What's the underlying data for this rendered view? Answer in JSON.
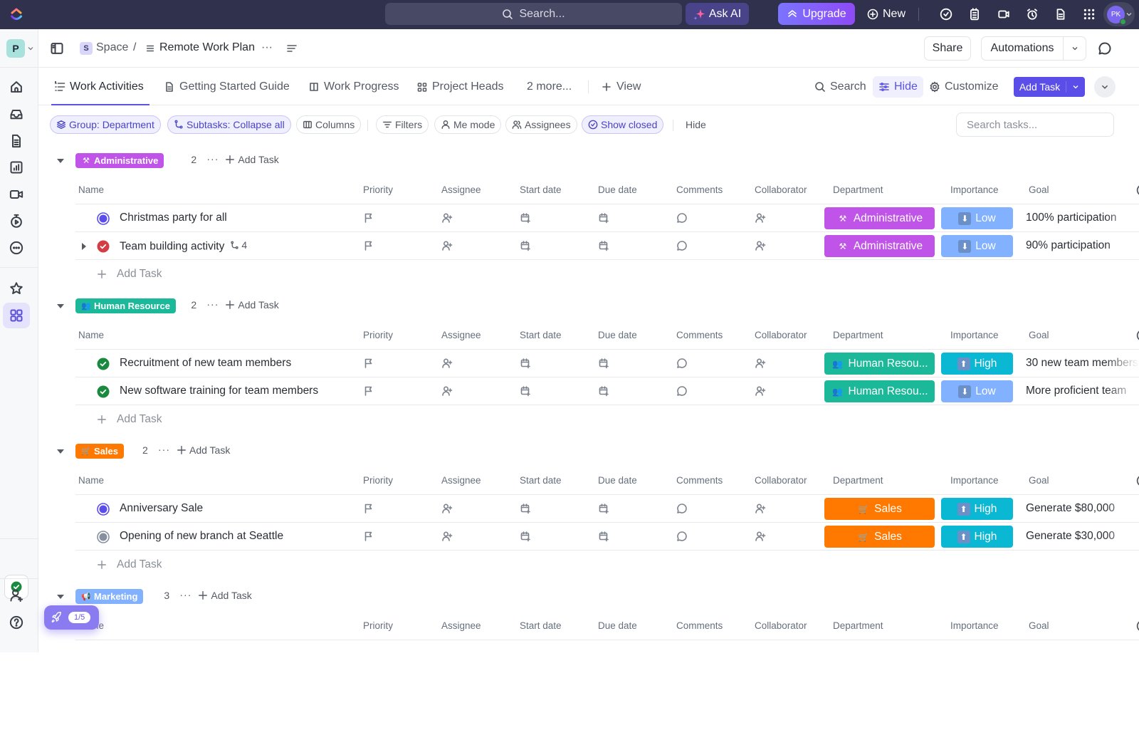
{
  "topbar": {
    "search_placeholder": "Search...",
    "ask_ai_label": "Ask AI",
    "upgrade_label": "Upgrade",
    "new_label": "New",
    "avatar_initials": "PK"
  },
  "rail": {
    "workspace_initial": "P",
    "icons": [
      "home-icon",
      "inbox-icon",
      "docs-icon",
      "dashboards-icon",
      "clips-icon",
      "timesheet-icon",
      "more-icon",
      "favorites-icon",
      "spaces-icon"
    ]
  },
  "header": {
    "space_badge": "S",
    "space_label": "Space",
    "separator": "/",
    "list_title": "Remote Work Plan",
    "more": "···",
    "share_label": "Share",
    "automations_label": "Automations"
  },
  "tabs": {
    "items": [
      {
        "label": "Work Activities",
        "active": true
      },
      {
        "label": "Getting Started Guide",
        "active": false
      },
      {
        "label": "Work Progress",
        "active": false
      },
      {
        "label": "Project Heads",
        "active": false
      }
    ],
    "more_label": "2 more...",
    "add_view_label": "View",
    "search_label": "Search",
    "hide_label": "Hide",
    "customize_label": "Customize",
    "add_task_label": "Add Task"
  },
  "filters": {
    "group_label": "Group: Department",
    "subtasks_label": "Subtasks: Collapse all",
    "columns_label": "Columns",
    "filters_label": "Filters",
    "me_mode_label": "Me mode",
    "assignees_label": "Assignees",
    "show_closed_label": "Show closed",
    "hide_label": "Hide",
    "search_placeholder": "Search tasks..."
  },
  "columns": [
    "Name",
    "Priority",
    "Assignee",
    "Start date",
    "Due date",
    "Comments",
    "Collaborator",
    "Department",
    "Importance",
    "Goal"
  ],
  "add_task_label": "Add Task",
  "colors": {
    "accent": "#5b4de8",
    "administrative": "#c053e8",
    "human_resource": "#1bb99a",
    "sales": "#ff7800",
    "marketing": "#81b1ff",
    "importance_low": "#81b1ff",
    "importance_high": "#0ab8d4"
  },
  "groups": [
    {
      "name": "Administrative",
      "emoji": "⚒",
      "count": "2",
      "color": "#c053e8",
      "tasks": [
        {
          "name": "Christmas party for all",
          "status": "in-progress",
          "subtasks": "",
          "department": "Administrative",
          "importance": "Low",
          "goal": "100% participation"
        },
        {
          "name": "Team building activity",
          "status": "complete-red",
          "subtasks": "4",
          "department": "Administrative",
          "importance": "Low",
          "goal": "90% participation"
        }
      ]
    },
    {
      "name": "Human Resource",
      "emoji": "👥",
      "count": "2",
      "color": "#1bb99a",
      "tasks": [
        {
          "name": "Recruitment of new team members",
          "status": "complete",
          "subtasks": "",
          "department": "Human Resou...",
          "importance": "High",
          "goal": "30 new team members"
        },
        {
          "name": "New software training for team members",
          "status": "complete",
          "subtasks": "",
          "department": "Human Resou...",
          "importance": "Low",
          "goal": "More proficient team"
        }
      ]
    },
    {
      "name": "Sales",
      "emoji": "🛒",
      "count": "2",
      "color": "#ff7800",
      "tasks": [
        {
          "name": "Anniversary Sale",
          "status": "in-progress",
          "subtasks": "",
          "department": "Sales",
          "importance": "High",
          "goal": "Generate $80,000"
        },
        {
          "name": "Opening of new branch at Seattle",
          "status": "open",
          "subtasks": "",
          "department": "Sales",
          "importance": "High",
          "goal": "Generate $30,000"
        }
      ]
    },
    {
      "name": "Marketing",
      "emoji": "📢",
      "count": "3",
      "color": "#81b1ff",
      "tasks": []
    }
  ],
  "onboarding": {
    "progress": "1/5"
  }
}
